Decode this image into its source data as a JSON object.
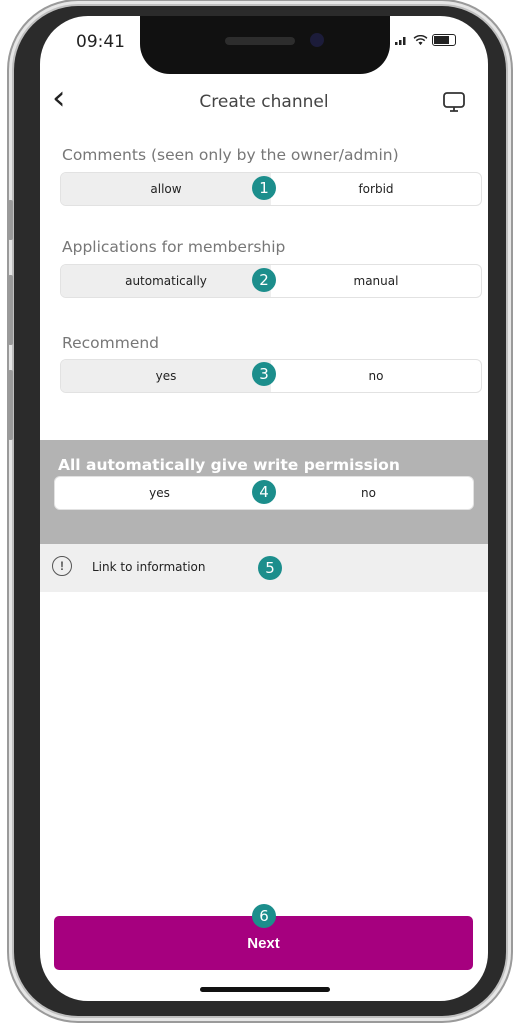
{
  "status_bar": {
    "time": "09:41",
    "signal_icon": "cellular-signal-icon",
    "wifi_icon": "wifi-icon",
    "battery_icon": "battery-icon"
  },
  "header": {
    "back_icon": "chevron-left-icon",
    "back_glyph": "‹",
    "title": "Create channel",
    "cast_icon": "monitor-icon"
  },
  "sections": [
    {
      "label": "Comments (seen only by the owner/admin)",
      "options": [
        "allow",
        "forbid"
      ],
      "selected": 0,
      "marker": "1"
    },
    {
      "label": "Applications for membership",
      "options": [
        "automatically",
        "manual"
      ],
      "selected": 0,
      "marker": "2"
    },
    {
      "label": "Recommend",
      "options": [
        "yes",
        "no"
      ],
      "selected": 0,
      "marker": "3"
    }
  ],
  "write_permission": {
    "label": "All automatically give write permission",
    "options": [
      "yes",
      "no"
    ],
    "selected": 0,
    "marker": "4"
  },
  "info_link": {
    "icon": "exclamation-circle-icon",
    "glyph": "!",
    "label": "Link to information",
    "marker": "5"
  },
  "next_button": {
    "label": "Next",
    "marker": "6"
  },
  "colors": {
    "accent": "#a6007f",
    "marker": "#1c8e8c",
    "band": "#b3b3b3"
  }
}
